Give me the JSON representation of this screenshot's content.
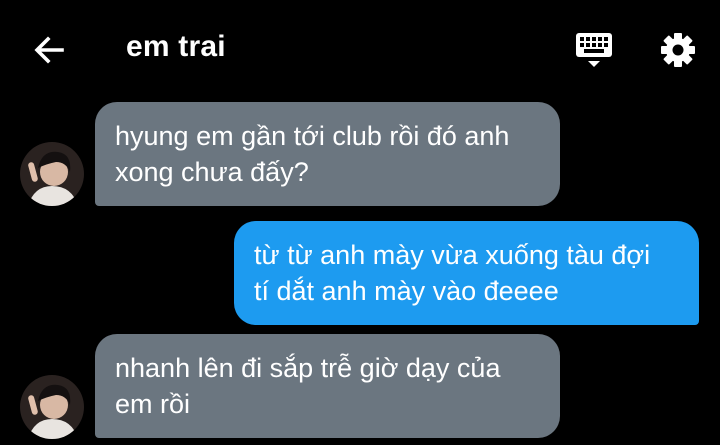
{
  "header": {
    "back_icon": "arrow-left-icon",
    "title": "em trai",
    "keyboard_icon": "keyboard-icon",
    "settings_icon": "gear-icon"
  },
  "messages": [
    {
      "direction": "incoming",
      "text": "hyung em gần tới club rồi đó anh\nxong chưa đấy?"
    },
    {
      "direction": "outgoing",
      "text": "từ từ anh mày vừa xuống tàu đợi\ntí dắt anh mày vào đeeee"
    },
    {
      "direction": "incoming",
      "text": "nhanh lên đi sắp trễ giờ dạy của\nem rồi"
    }
  ],
  "colors": {
    "background": "#000000",
    "incoming_bubble": "#6b7680",
    "outgoing_bubble": "#1d9bf0",
    "text": "#ffffff"
  }
}
